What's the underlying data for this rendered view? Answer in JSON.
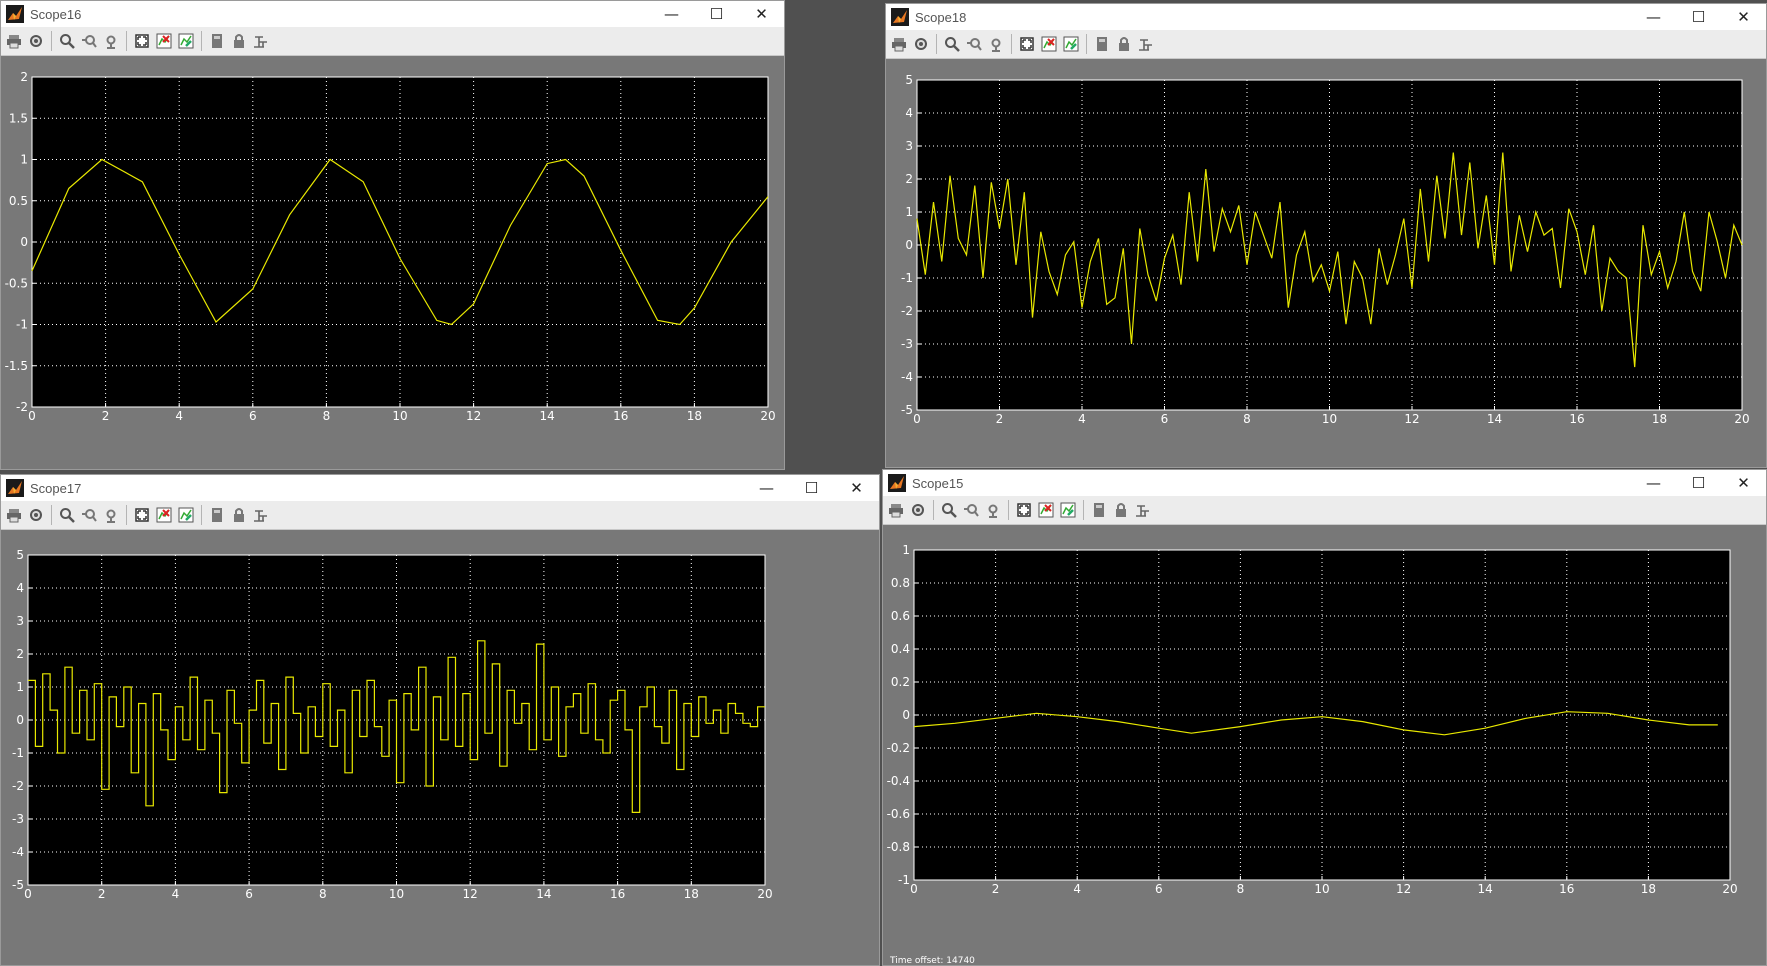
{
  "colors": {
    "trace": "#e8e800",
    "axes_bg": "#000000",
    "grid": "#ffffff",
    "figure_bg": "#787878",
    "tick_text": "#ffffff"
  },
  "toolbar_icons": [
    "print-icon",
    "parameters-icon",
    "zoom-icon",
    "zoom-x-icon",
    "zoom-y-icon",
    "autoscale-icon",
    "save-axes-settings-icon",
    "restore-axes-settings-icon",
    "floating-scope-icon",
    "lock-axes-icon",
    "signal-selection-icon"
  ],
  "window_controls": {
    "minimize": "—",
    "maximize": "☐",
    "close": "✕"
  },
  "footer": {
    "time_offset_label": "Time offset:",
    "time_offset_value": "14740"
  },
  "windows": [
    {
      "title": "Scope16",
      "chart_data": {
        "type": "line",
        "title": "",
        "xlabel": "",
        "ylabel": "",
        "xlim": [
          0,
          20
        ],
        "ylim": [
          -2,
          2
        ],
        "x_ticks": [
          "0",
          "2",
          "4",
          "6",
          "8",
          "10",
          "12",
          "14",
          "16",
          "18",
          "20"
        ],
        "y_ticks": [
          "2",
          "1.5",
          "1",
          "0.5",
          "0",
          "-0.5",
          "-1",
          "-1.5",
          "-2"
        ],
        "grid": true,
        "series": [
          {
            "x": [
              0,
              1,
              1.9,
              3,
              4,
              5,
              6,
              7,
              8.1,
              9,
              10,
              11,
              11.4,
              12,
              13,
              14,
              14.5,
              15,
              16,
              17,
              17.6,
              18,
              19,
              20
            ],
            "values": [
              -0.35,
              0.65,
              1.0,
              0.73,
              -0.15,
              -0.97,
              -0.57,
              0.33,
              1.0,
              0.73,
              -0.2,
              -0.95,
              -1.0,
              -0.75,
              0.2,
              0.95,
              1.0,
              0.8,
              -0.1,
              -0.95,
              -1.0,
              -0.8,
              0.0,
              0.55
            ]
          }
        ]
      }
    },
    {
      "title": "Scope18",
      "chart_data": {
        "type": "line",
        "title": "",
        "xlabel": "",
        "ylabel": "",
        "xlim": [
          0,
          20
        ],
        "ylim": [
          -5,
          5
        ],
        "x_ticks": [
          "0",
          "2",
          "4",
          "6",
          "8",
          "10",
          "12",
          "14",
          "16",
          "18",
          "20"
        ],
        "y_ticks": [
          "5",
          "4",
          "3",
          "2",
          "1",
          "0",
          "-1",
          "-2",
          "-3",
          "-4",
          "-5"
        ],
        "grid": true,
        "series": [
          {
            "x": [
              0,
              0.2,
              0.4,
              0.6,
              0.8,
              1.0,
              1.2,
              1.4,
              1.6,
              1.8,
              2.0,
              2.2,
              2.4,
              2.6,
              2.8,
              3.0,
              3.2,
              3.4,
              3.6,
              3.8,
              4.0,
              4.2,
              4.4,
              4.6,
              4.8,
              5.0,
              5.2,
              5.4,
              5.6,
              5.8,
              6.0,
              6.2,
              6.4,
              6.6,
              6.8,
              7.0,
              7.2,
              7.4,
              7.6,
              7.8,
              8.0,
              8.2,
              8.4,
              8.6,
              8.8,
              9.0,
              9.2,
              9.4,
              9.6,
              9.8,
              10.0,
              10.2,
              10.4,
              10.6,
              10.8,
              11.0,
              11.2,
              11.4,
              11.6,
              11.8,
              12.0,
              12.2,
              12.4,
              12.6,
              12.8,
              13.0,
              13.2,
              13.4,
              13.6,
              13.8,
              14.0,
              14.2,
              14.4,
              14.6,
              14.8,
              15.0,
              15.2,
              15.4,
              15.6,
              15.8,
              16.0,
              16.2,
              16.4,
              16.6,
              16.8,
              17.0,
              17.2,
              17.4,
              17.6,
              17.8,
              18.0,
              18.2,
              18.4,
              18.6,
              18.8,
              19.0,
              19.2,
              19.4,
              19.6,
              19.8,
              20.0
            ],
            "values": [
              0.8,
              -0.9,
              1.3,
              -0.5,
              2.1,
              0.2,
              -0.3,
              1.8,
              -1.0,
              1.9,
              0.5,
              2.0,
              -0.6,
              1.6,
              -2.2,
              0.4,
              -0.8,
              -1.5,
              -0.3,
              0.1,
              -1.9,
              -0.5,
              0.2,
              -1.8,
              -1.6,
              -0.1,
              -3.0,
              0.5,
              -0.9,
              -1.7,
              -0.4,
              0.3,
              -1.2,
              1.6,
              -0.5,
              2.3,
              -0.2,
              1.1,
              0.4,
              1.2,
              -0.6,
              1.0,
              0.3,
              -0.4,
              1.3,
              -1.9,
              -0.3,
              0.4,
              -1.1,
              -0.6,
              -1.4,
              -0.2,
              -2.4,
              -0.5,
              -1.0,
              -2.4,
              -0.1,
              -1.2,
              -0.3,
              0.8,
              -1.3,
              1.7,
              -0.5,
              2.1,
              0.2,
              2.8,
              0.3,
              2.5,
              -0.1,
              1.5,
              -0.6,
              2.8,
              -0.8,
              0.9,
              -0.2,
              1.0,
              0.3,
              0.5,
              -1.3,
              1.1,
              0.4,
              -0.9,
              0.6,
              -2.0,
              -0.4,
              -0.8,
              -1.0,
              -3.7,
              0.6,
              -0.9,
              -0.2,
              -1.3,
              -0.5,
              1.0,
              -0.8,
              -1.4,
              1.0,
              0.1,
              -1.0,
              0.6,
              0.0
            ]
          }
        ]
      }
    },
    {
      "title": "Scope17",
      "chart_data": {
        "type": "line",
        "title": "",
        "xlabel": "",
        "ylabel": "",
        "xlim": [
          0,
          20
        ],
        "ylim": [
          -5,
          5
        ],
        "x_ticks": [
          "0",
          "2",
          "4",
          "6",
          "8",
          "10",
          "12",
          "14",
          "16",
          "18",
          "20"
        ],
        "y_ticks": [
          "5",
          "4",
          "3",
          "2",
          "1",
          "0",
          "-1",
          "-2",
          "-3",
          "-4",
          "-5"
        ],
        "grid": true,
        "step": true,
        "series": [
          {
            "x": [
              0,
              0.2,
              0.4,
              0.6,
              0.8,
              1.0,
              1.2,
              1.4,
              1.6,
              1.8,
              2.0,
              2.2,
              2.4,
              2.6,
              2.8,
              3.0,
              3.2,
              3.4,
              3.6,
              3.8,
              4.0,
              4.2,
              4.4,
              4.6,
              4.8,
              5.0,
              5.2,
              5.4,
              5.6,
              5.8,
              6.0,
              6.2,
              6.4,
              6.6,
              6.8,
              7.0,
              7.2,
              7.4,
              7.6,
              7.8,
              8.0,
              8.2,
              8.4,
              8.6,
              8.8,
              9.0,
              9.2,
              9.4,
              9.6,
              9.8,
              10.0,
              10.2,
              10.4,
              10.6,
              10.8,
              11.0,
              11.2,
              11.4,
              11.6,
              11.8,
              12.0,
              12.2,
              12.4,
              12.6,
              12.8,
              13.0,
              13.2,
              13.4,
              13.6,
              13.8,
              14.0,
              14.2,
              14.4,
              14.6,
              14.8,
              15.0,
              15.2,
              15.4,
              15.6,
              15.8,
              16.0,
              16.2,
              16.4,
              16.6,
              16.8,
              17.0,
              17.2,
              17.4,
              17.6,
              17.8,
              18.0,
              18.2,
              18.4,
              18.6,
              18.8,
              19.0,
              19.2,
              19.4,
              19.6,
              19.8
            ],
            "values": [
              1.2,
              -0.8,
              1.4,
              0.3,
              -1.0,
              1.6,
              -0.4,
              0.9,
              -0.6,
              1.1,
              -2.1,
              0.7,
              -0.2,
              1.0,
              -1.6,
              0.5,
              -2.6,
              0.8,
              -0.3,
              -1.2,
              0.4,
              -0.6,
              1.3,
              -0.9,
              0.6,
              -0.4,
              -2.2,
              0.9,
              -0.1,
              -1.3,
              0.3,
              1.2,
              -0.7,
              0.5,
              -1.5,
              1.3,
              0.2,
              -1.0,
              0.4,
              -0.5,
              1.1,
              -0.8,
              0.3,
              -1.6,
              0.9,
              -0.5,
              1.2,
              -0.2,
              -1.1,
              0.6,
              -1.9,
              0.8,
              -0.3,
              1.6,
              -2.0,
              0.7,
              -0.6,
              1.9,
              -0.8,
              0.8,
              -1.2,
              2.4,
              -0.4,
              1.7,
              -1.4,
              0.9,
              -0.1,
              0.5,
              -0.9,
              2.3,
              -0.6,
              1.0,
              -1.1,
              0.4,
              0.8,
              -0.4,
              1.1,
              -0.6,
              -1.0,
              0.6,
              0.9,
              -0.3,
              -2.8,
              0.4,
              1.0,
              -0.2,
              -0.7,
              0.9,
              -1.5,
              0.5,
              -0.5,
              0.7,
              -0.1,
              0.3,
              -0.4,
              0.5,
              0.2,
              -0.1,
              -0.2,
              0.4
            ]
          }
        ]
      }
    },
    {
      "title": "Scope15",
      "chart_data": {
        "type": "line",
        "title": "",
        "xlabel": "",
        "ylabel": "",
        "xlim": [
          0,
          20
        ],
        "ylim": [
          -1,
          1
        ],
        "x_ticks": [
          "0",
          "2",
          "4",
          "6",
          "8",
          "10",
          "12",
          "14",
          "16",
          "18",
          "20"
        ],
        "y_ticks": [
          "1",
          "0.8",
          "0.6",
          "0.4",
          "0.2",
          "0",
          "-0.2",
          "-0.4",
          "-0.6",
          "-0.8",
          "-1"
        ],
        "grid": true,
        "series": [
          {
            "x": [
              0,
              1,
              2,
              3,
              4,
              5,
              6,
              6.8,
              8,
              9,
              10,
              11,
              12,
              13,
              14,
              15,
              16,
              17,
              18,
              19,
              19.7
            ],
            "values": [
              -0.07,
              -0.05,
              -0.02,
              0.01,
              -0.01,
              -0.04,
              -0.08,
              -0.11,
              -0.07,
              -0.03,
              -0.01,
              -0.04,
              -0.09,
              -0.12,
              -0.08,
              -0.02,
              0.02,
              0.01,
              -0.03,
              -0.06,
              -0.06
            ]
          }
        ]
      }
    }
  ]
}
